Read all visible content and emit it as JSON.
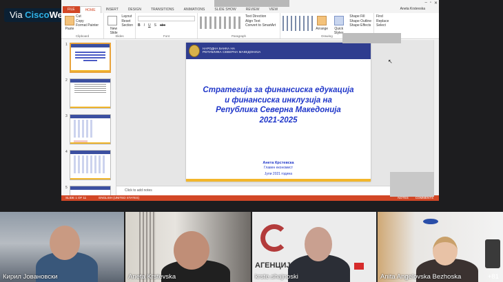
{
  "webex_badge": {
    "prefix": "Via ",
    "brand_a": "Cisco",
    "brand_b": "Webex"
  },
  "powerpoint": {
    "user_name": "Aneta Krstevska",
    "tabs": [
      "FILE",
      "HOME",
      "INSERT",
      "DESIGN",
      "TRANSITIONS",
      "ANIMATIONS",
      "SLIDE SHOW",
      "REVIEW",
      "VIEW"
    ],
    "active_tab": "HOME",
    "ribbon": {
      "clipboard": {
        "label": "Clipboard",
        "paste": "Paste",
        "cut": "Cut",
        "copy": "Copy",
        "format_painter": "Format Painter"
      },
      "slides": {
        "label": "Slides",
        "new_slide": "New Slide",
        "layout": "Layout",
        "reset": "Reset",
        "section": "Section"
      },
      "font": {
        "label": "Font",
        "bold": "B",
        "italic": "I",
        "underline": "U",
        "shadow": "S",
        "strike": "abc"
      },
      "paragraph": {
        "label": "Paragraph",
        "text_direction": "Text Direction",
        "align_text": "Align Text",
        "smartart": "Convert to SmartArt"
      },
      "drawing": {
        "label": "Drawing",
        "arrange": "Arrange",
        "quick_styles": "Quick Styles",
        "shape_fill": "Shape Fill",
        "shape_outline": "Shape Outline",
        "shape_effects": "Shape Effects"
      },
      "editing": {
        "label": "Editing",
        "find": "Find",
        "replace": "Replace",
        "select": "Select"
      }
    },
    "thumbnails": [
      {
        "num": "1"
      },
      {
        "num": "2"
      },
      {
        "num": "3"
      },
      {
        "num": "4"
      },
      {
        "num": "5"
      }
    ],
    "slide": {
      "institution": "НАРОДНА БАНКА НА\nРЕПУБЛИКА СЕВЕРНА МАКЕДОНИЈА",
      "title_lines": [
        "Стратегија за финансиска едукација",
        "и финансиска инклузија на",
        "Република Северна Македонија",
        "2021-2025"
      ],
      "author": "Анета Крстевска",
      "role": "Главен економист",
      "date": "Јули 2021 година"
    },
    "notes_placeholder": "Click to add notes",
    "statusbar": {
      "slide_count": "SLIDE 1 OF 11",
      "language": "ENGLISH (UNITED STATES)",
      "notes": "NOTES",
      "comments": "COMMENTS"
    }
  },
  "participants": [
    {
      "name": "Кирил Јовановски"
    },
    {
      "name": "Aneta Krstevska"
    },
    {
      "name": "krste.shajnoski"
    },
    {
      "name": "Anita Angelovska Bezhoska"
    }
  ],
  "tile_text": {
    "agency_partial": "АГЕНЦИЈА ЗА"
  },
  "extra_participants": "+81",
  "colors": {
    "ppt_accent": "#d24726",
    "slide_title": "#1f36c9",
    "slide_header": "#2f3d8f",
    "slide_footer": "#f2b62b",
    "webex_cisco": "#2fb2e8"
  }
}
